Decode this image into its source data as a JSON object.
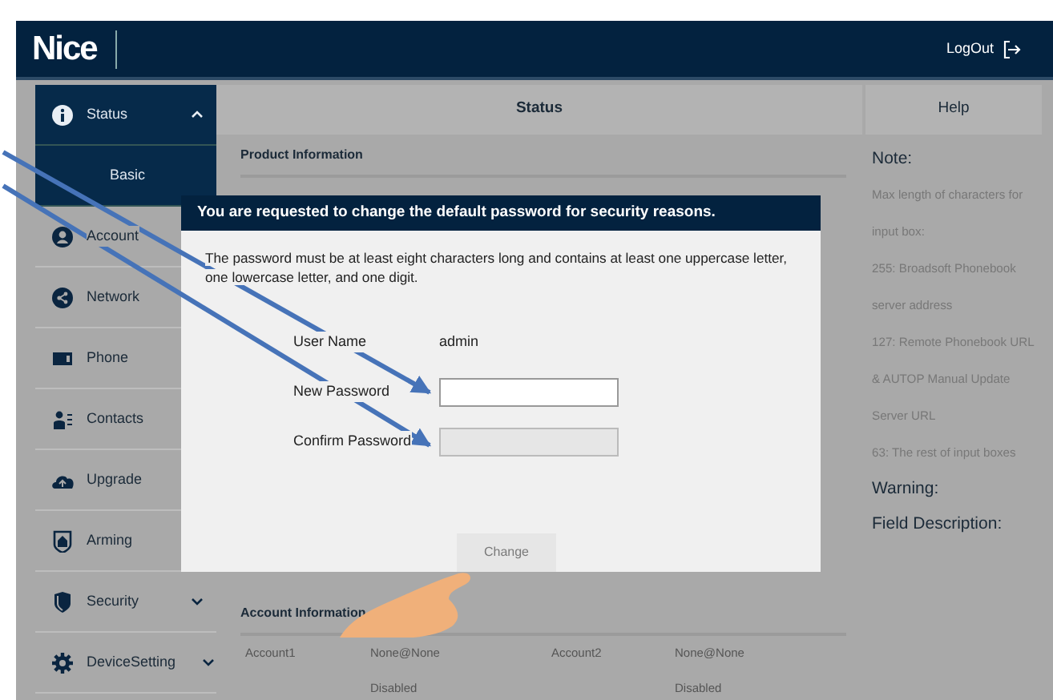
{
  "header": {
    "logo": "Nice",
    "logout": "LogOut"
  },
  "sidebar": {
    "items": [
      {
        "label": "Status",
        "kind": "group",
        "selected": true,
        "expanded": true,
        "has_children": true
      },
      {
        "label": "Basic",
        "kind": "subitem",
        "selected": true
      },
      {
        "label": "Account",
        "kind": "item",
        "selected": false
      },
      {
        "label": "Network",
        "kind": "item",
        "selected": false
      },
      {
        "label": "Phone",
        "kind": "item",
        "selected": false
      },
      {
        "label": "Contacts",
        "kind": "item",
        "selected": false
      },
      {
        "label": "Upgrade",
        "kind": "item",
        "selected": false
      },
      {
        "label": "Arming",
        "kind": "item",
        "selected": false
      },
      {
        "label": "Security",
        "kind": "group",
        "selected": false,
        "expanded": false,
        "has_children": true
      },
      {
        "label": "DeviceSetting",
        "kind": "group",
        "selected": false,
        "expanded": false,
        "has_children": true
      }
    ]
  },
  "content": {
    "title": "Status",
    "sections": [
      {
        "title": "Product Information"
      },
      {
        "title": "Account Information",
        "rows": [
          [
            "Account1",
            "None@None",
            "Account2",
            "None@None"
          ],
          [
            "",
            "Disabled",
            "",
            "Disabled"
          ]
        ]
      }
    ]
  },
  "help": {
    "title": "Help",
    "blocks": [
      {
        "kind": "heading",
        "text": "Note:"
      },
      {
        "kind": "line",
        "text": "Max length of characters for"
      },
      {
        "kind": "line",
        "text": "input box:"
      },
      {
        "kind": "line",
        "text": "255: Broadsoft Phonebook"
      },
      {
        "kind": "line",
        "text": "server address"
      },
      {
        "kind": "line",
        "text": "127: Remote Phonebook URL"
      },
      {
        "kind": "line",
        "text": "& AUTOP Manual Update"
      },
      {
        "kind": "line",
        "text": "Server URL"
      },
      {
        "kind": "line",
        "text": "63: The rest of input boxes"
      },
      {
        "kind": "heading",
        "text": "Warning:"
      },
      {
        "kind": "heading",
        "text": "Field Description:"
      }
    ]
  },
  "dialog": {
    "title": "You are requested to change the default password for security reasons.",
    "message": "The password must be at least eight characters long and contains at least one uppercase letter, one lowercase letter, and one digit.",
    "fields": [
      {
        "label": "User Name",
        "kind": "text",
        "value": "admin"
      },
      {
        "label": "New Password",
        "kind": "input",
        "disabled": false
      },
      {
        "label": "Confirm Password",
        "kind": "input",
        "disabled": true
      }
    ],
    "button": {
      "label": "Change",
      "disabled": true
    }
  }
}
